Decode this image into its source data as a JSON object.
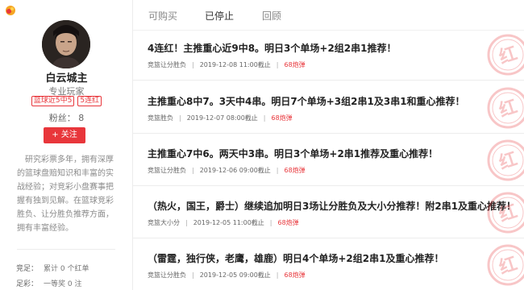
{
  "profile": {
    "name": "白云城主",
    "title": "专业玩家",
    "badges": [
      "篮球近5中5",
      "5连红"
    ],
    "fans_label": "粉丝：",
    "fans_count": "8",
    "follow_label": "+ 关注",
    "bio": "研究彩票多年，拥有深厚的篮球盘赔知识和丰富的实战经验；对竞彩小盘赛事把握有独到见解。在篮球竞彩胜负、让分胜负推荐方面，拥有丰富经验。",
    "stats": [
      {
        "key": "竞足：",
        "value": "累计 0 个红单"
      },
      {
        "key": "足彩：",
        "value": "一等奖 0 注"
      }
    ]
  },
  "tabs": [
    {
      "label": "可购买",
      "active": false
    },
    {
      "label": "已停止",
      "active": true
    },
    {
      "label": "回顾",
      "active": false
    }
  ],
  "items": [
    {
      "title": "4连红！主推重心近9中8。明日3个单场+2组2串1推荐！",
      "category": "竞篮让分胜负",
      "time": "2019-12-08 11:00截止",
      "price": "68炮弹"
    },
    {
      "title": "主推重心8中7。3天中4串。明日7个单场+3组2串1及3串1和重心推荐！",
      "category": "竞篮胜负",
      "time": "2019-12-07 08:00截止",
      "price": "68炮弹"
    },
    {
      "title": "主推重心7中6。两天中3串。明日3个单场+2串1推荐及重心推荐！",
      "category": "竞篮让分胜负",
      "time": "2019-12-06 09:00截止",
      "price": "68炮弹"
    },
    {
      "title": "（热火，国王，爵士）继续追加明日3场让分胜负及大小分推荐！附2串1及重心推荐！",
      "category": "竞篮大小分",
      "time": "2019-12-05 11:00截止",
      "price": "68炮弹"
    },
    {
      "title": "（雷霆，独行侠，老鹰，雄鹿）明日4个单场+2组2串1及重心推荐！",
      "category": "竞篮让分胜负",
      "time": "2019-12-05 09:00截止",
      "price": "68炮弹"
    }
  ],
  "stamp_text": "红",
  "colors": {
    "accent": "#e8363b",
    "logo": "#f5a623"
  },
  "icons": {
    "logo": "logo-icon",
    "stamp": "red-stamp-icon"
  }
}
